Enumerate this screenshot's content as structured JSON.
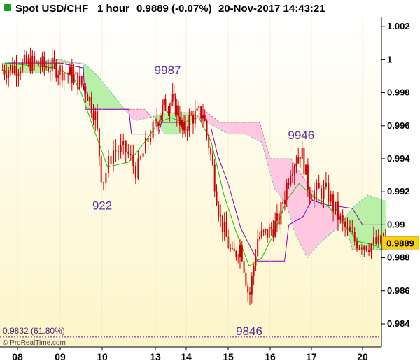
{
  "header": {
    "symbol": "Spot USD/CHF",
    "timeframe": "1 hour",
    "last_change": "0.9889 (-0.07%)",
    "datetime": "20-Nov-2017 14:43:21"
  },
  "credit": "© ProRealTime.com",
  "fibo": {
    "label": "0.9832 (61.80%)",
    "value": 0.9832,
    "color": "#6a1a9a"
  },
  "last_price": {
    "label": "0.9889",
    "value": 0.9889,
    "box_color": "#ffd200"
  },
  "colors": {
    "bg_top": "#ffffff",
    "bg_bottom": "#fdf5c8",
    "candle": "#cc0000",
    "tenkan": "#00cc00",
    "kijun": "#8800bb",
    "cloud_bull": "#b8f0a8",
    "cloud_bear": "#ffc8e0",
    "span_line": "#55cccc"
  },
  "chart_data": {
    "type": "candlestick",
    "title": "Spot USD/CHF",
    "ylim": [
      0.9826,
      1.0026
    ],
    "y_ticks": [
      {
        "label": "1.002",
        "value": 1.002
      },
      {
        "label": "1",
        "value": 1.0
      },
      {
        "label": "0.998",
        "value": 0.998
      },
      {
        "label": "0.996",
        "value": 0.996
      },
      {
        "label": "0.994",
        "value": 0.994
      },
      {
        "label": "0.992",
        "value": 0.992
      },
      {
        "label": "0.99",
        "value": 0.99
      },
      {
        "label": "0.988",
        "value": 0.988
      },
      {
        "label": "0.986",
        "value": 0.986
      },
      {
        "label": "0.984",
        "value": 0.984
      }
    ],
    "x_ticks": [
      "08",
      "09",
      "10",
      "13",
      "14",
      "15",
      "16",
      "17",
      "20"
    ],
    "annotations": [
      {
        "label": "9987",
        "value": 0.9987,
        "x_index": 3
      },
      {
        "label": "922",
        "value": 0.9922,
        "x_index": 2
      },
      {
        "label": "9946",
        "value": 0.9946,
        "x_index": 7
      },
      {
        "label": "9846",
        "value": 0.9846,
        "x_index": 6
      }
    ],
    "price_path": [
      [
        -0.3,
        0.9994
      ],
      [
        0.3,
        0.9998
      ],
      [
        0.9,
        0.9995
      ],
      [
        1.3,
        0.999
      ],
      [
        1.6,
        0.9983
      ],
      [
        1.85,
        0.9965
      ],
      [
        2.0,
        0.9925
      ],
      [
        2.2,
        0.9945
      ],
      [
        2.45,
        0.9945
      ],
      [
        2.65,
        0.9932
      ],
      [
        2.9,
        0.9955
      ],
      [
        3.1,
        0.9965
      ],
      [
        3.3,
        0.9972
      ],
      [
        3.55,
        0.9975
      ],
      [
        3.75,
        0.9968
      ],
      [
        3.9,
        0.9955
      ],
      [
        4.1,
        0.9965
      ],
      [
        4.4,
        0.9968
      ],
      [
        4.6,
        0.994
      ],
      [
        4.8,
        0.9905
      ],
      [
        5.1,
        0.988
      ],
      [
        5.3,
        0.9888
      ],
      [
        5.5,
        0.9855
      ],
      [
        5.7,
        0.9892
      ],
      [
        5.95,
        0.9895
      ],
      [
        6.2,
        0.9902
      ],
      [
        6.5,
        0.9935
      ],
      [
        6.75,
        0.9945
      ],
      [
        6.95,
        0.992
      ],
      [
        7.3,
        0.992
      ],
      [
        7.6,
        0.99
      ],
      [
        7.85,
        0.989
      ],
      [
        8.15,
        0.9888
      ],
      [
        8.4,
        0.9889
      ]
    ],
    "tenkan": [
      [
        -0.3,
        0.9998
      ],
      [
        0.9,
        0.9995
      ],
      [
        1.3,
        0.999
      ],
      [
        1.5,
        0.998
      ],
      [
        1.8,
        0.9958
      ],
      [
        2.1,
        0.9935
      ],
      [
        2.5,
        0.9938
      ],
      [
        2.8,
        0.995
      ],
      [
        3.1,
        0.9962
      ],
      [
        3.5,
        0.9965
      ],
      [
        3.9,
        0.9962
      ],
      [
        4.3,
        0.9965
      ],
      [
        4.6,
        0.995
      ],
      [
        4.9,
        0.9918
      ],
      [
        5.2,
        0.9895
      ],
      [
        5.5,
        0.9875
      ],
      [
        5.8,
        0.988
      ],
      [
        6.1,
        0.9895
      ],
      [
        6.4,
        0.9915
      ],
      [
        6.7,
        0.9925
      ],
      [
        7.0,
        0.9918
      ],
      [
        7.3,
        0.9912
      ],
      [
        7.6,
        0.9902
      ],
      [
        7.9,
        0.989
      ],
      [
        8.2,
        0.9888
      ],
      [
        8.4,
        0.9885
      ]
    ],
    "kijun": [
      [
        -0.3,
        0.9998
      ],
      [
        1.0,
        0.9998
      ],
      [
        1.55,
        0.9995
      ],
      [
        1.6,
        0.997
      ],
      [
        2.5,
        0.997
      ],
      [
        2.55,
        0.9955
      ],
      [
        3.1,
        0.9955
      ],
      [
        3.2,
        0.9962
      ],
      [
        3.8,
        0.9962
      ],
      [
        3.9,
        0.9958
      ],
      [
        4.6,
        0.9958
      ],
      [
        4.75,
        0.9942
      ],
      [
        5.0,
        0.9925
      ],
      [
        5.3,
        0.9898
      ],
      [
        5.7,
        0.9878
      ],
      [
        6.35,
        0.9878
      ],
      [
        6.45,
        0.99
      ],
      [
        6.8,
        0.9905
      ],
      [
        7.0,
        0.9915
      ],
      [
        7.3,
        0.9912
      ],
      [
        7.8,
        0.991
      ],
      [
        8.0,
        0.99
      ],
      [
        8.4,
        0.99
      ]
    ],
    "span_a": [
      [
        -0.3,
        0.9998
      ],
      [
        1.0,
        1.0
      ],
      [
        1.6,
        0.9997
      ],
      [
        1.9,
        0.999
      ],
      [
        2.3,
        0.9975
      ],
      [
        2.6,
        0.9963
      ],
      [
        2.9,
        0.9965
      ],
      [
        3.3,
        0.9968
      ],
      [
        3.7,
        0.9968
      ],
      [
        4.1,
        0.9968
      ],
      [
        4.5,
        0.9962
      ],
      [
        5.0,
        0.9955
      ],
      [
        5.4,
        0.9955
      ],
      [
        5.8,
        0.995
      ],
      [
        6.1,
        0.9922
      ],
      [
        6.4,
        0.9912
      ],
      [
        6.6,
        0.9895
      ],
      [
        6.9,
        0.988
      ],
      [
        7.2,
        0.989
      ],
      [
        7.5,
        0.9898
      ],
      [
        7.8,
        0.991
      ],
      [
        8.1,
        0.9918
      ],
      [
        8.4,
        0.9915
      ]
    ],
    "span_b": [
      [
        -0.3,
        0.9992
      ],
      [
        0.6,
        0.9992
      ],
      [
        1.0,
        0.9998
      ],
      [
        1.55,
        0.9998
      ],
      [
        1.6,
        0.997
      ],
      [
        2.2,
        0.997
      ],
      [
        2.8,
        0.997
      ],
      [
        3.3,
        0.9955
      ],
      [
        3.9,
        0.9955
      ],
      [
        4.4,
        0.997
      ],
      [
        4.8,
        0.9962
      ],
      [
        5.2,
        0.9962
      ],
      [
        5.75,
        0.9962
      ],
      [
        6.0,
        0.994
      ],
      [
        6.5,
        0.994
      ],
      [
        6.9,
        0.9925
      ],
      [
        7.2,
        0.9912
      ],
      [
        7.6,
        0.9908
      ],
      [
        7.8,
        0.9885
      ],
      [
        8.1,
        0.9885
      ],
      [
        8.4,
        0.9885
      ]
    ]
  }
}
